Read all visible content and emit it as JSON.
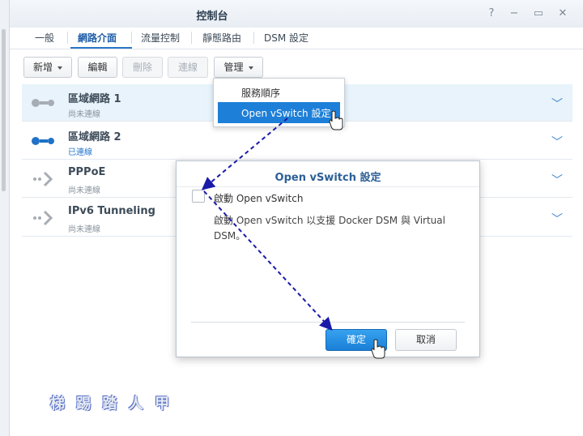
{
  "window": {
    "title": "控制台",
    "help_glyph": "?",
    "minimize_glyph": "−",
    "maximize_glyph": "▭",
    "close_glyph": "✕"
  },
  "tabs": [
    {
      "label": "一般"
    },
    {
      "label": "網路介面"
    },
    {
      "label": "流量控制"
    },
    {
      "label": "靜態路由"
    },
    {
      "label": "DSM 設定"
    }
  ],
  "toolbar": {
    "add_label": "新增",
    "edit_label": "編輯",
    "delete_label": "刪除",
    "connect_label": "連線",
    "manage_label": "管理"
  },
  "interfaces": [
    {
      "name": "區域網路 1",
      "status": "尚未連線"
    },
    {
      "name": "區域網路 2",
      "status": "已連線"
    },
    {
      "name": "PPPoE",
      "status": "尚未連線"
    },
    {
      "name": "IPv6 Tunneling",
      "status": "尚未連線"
    }
  ],
  "manage_menu": {
    "items": [
      {
        "label": "服務順序"
      },
      {
        "label": "Open vSwitch 設定"
      }
    ]
  },
  "dialog": {
    "title": "Open vSwitch 設定",
    "checkbox_label": "啟動 Open vSwitch",
    "description": "啟動 Open vSwitch 以支援 Docker DSM 與 Virtual DSM。",
    "ok_label": "確定",
    "cancel_label": "取消"
  },
  "watermark": "梯 踢 踏 人 甲",
  "colors": {
    "accent": "#1d7fd8",
    "connected": "#2477cf",
    "annotation_arrow": "#1a1aa8"
  }
}
